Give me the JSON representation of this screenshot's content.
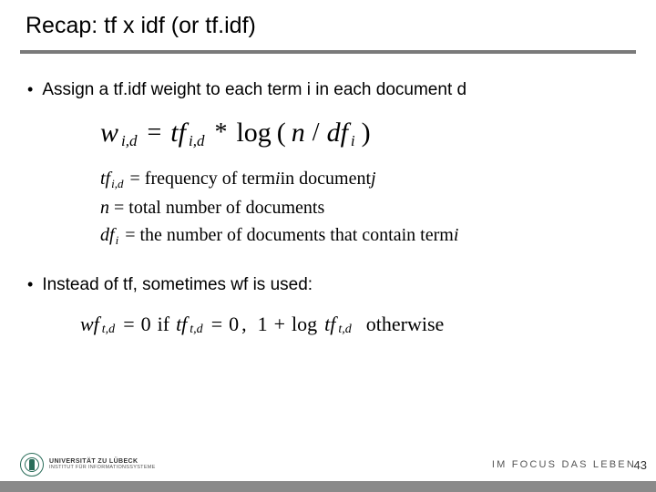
{
  "title": "Recap: tf x idf (or tf.idf)",
  "bullets": {
    "b1": "Assign a tf.idf weight to each term i in each document d",
    "b2": "Instead of tf, sometimes wf is used:"
  },
  "formula_main": {
    "w": "w",
    "w_sub": "i,d",
    "eq": "=",
    "tf": "tf",
    "tf_sub": "i,d",
    "mul": "*",
    "log": "log",
    "lp": "(",
    "n": "n",
    "slash": "/",
    "df": "df",
    "df_sub": "i",
    "rp": ")"
  },
  "definitions": {
    "d1": {
      "sym": "tf",
      "sub": "i,d",
      "eq": "=",
      "text": "frequency of term ",
      "i": "i",
      "mid": " in document ",
      "j": "j"
    },
    "d2": {
      "sym": "n",
      "eq": "=",
      "text": "total number of documents"
    },
    "d3": {
      "sym": "df",
      "sub": "i",
      "eq": "=",
      "text": "the number of documents that contain term ",
      "i": "i"
    }
  },
  "formula_wf": {
    "wf": "wf",
    "wf_sub": "t,d",
    "eq": "=",
    "zero1": "0",
    "iff": "if",
    "tf": "tf",
    "tf_sub": "t,d",
    "eq2": "=",
    "zero2": "0",
    "comma": ",",
    "one": "1",
    "plus": "+",
    "log": "log",
    "tf2": "tf",
    "tf2_sub": "t,d",
    "otherwise": "otherwise"
  },
  "footer": {
    "uni_name": "UNIVERSITÄT ZU LÜBECK",
    "uni_sub": "INSTITUT FÜR INFORMATIONSSYSTEME",
    "slogan": "IM FOCUS DAS LEBEN",
    "page": "43"
  }
}
